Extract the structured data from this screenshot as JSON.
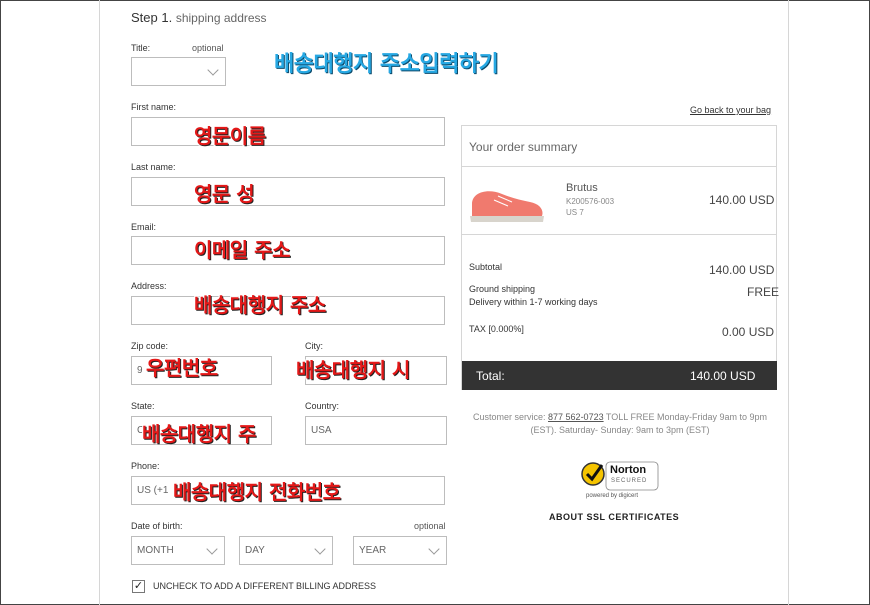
{
  "step": {
    "number": "Step 1.",
    "title": "shipping address"
  },
  "banner": "배송대행지 주소입력하기",
  "form": {
    "title_label": "Title:",
    "optional": "optional",
    "first_name_label": "First name:",
    "last_name_label": "Last name:",
    "email_label": "Email:",
    "address_label": "Address:",
    "zip_label": "Zip code:",
    "zip_value": "9",
    "city_label": "City:",
    "state_label": "State:",
    "state_value": "C",
    "country_label": "Country:",
    "country_value": "USA",
    "phone_label": "Phone:",
    "phone_value": "US (+1",
    "dob_label": "Date of birth:",
    "dob_optional": "optional",
    "month": "MONTH",
    "day": "DAY",
    "year": "YEAR",
    "billing_check": "UNCHECK TO ADD A DIFFERENT BILLING ADDRESS",
    "billing_checked": true
  },
  "annotations": {
    "first_name": "영문이름",
    "last_name": "영문 성",
    "email": "이메일 주소",
    "address": "배송대행지 주소",
    "zip": "우편번호",
    "city": "배송대행지 시",
    "state": "배송대행지 주",
    "phone": "배송대행지 전화번호"
  },
  "summary": {
    "back_link": "Go back to your bag",
    "title": "Your order summary",
    "product_name": "Brutus",
    "product_code": "K200576-003",
    "product_size": "US 7",
    "product_price": "140.00 USD",
    "subtotal_label": "Subtotal",
    "subtotal_value": "140.00 USD",
    "shipping_label": "Ground shipping",
    "shipping_note": "Delivery  within 1-7 working days",
    "shipping_value": "FREE",
    "tax_label": "TAX [0.000%]",
    "tax_value": "0.00 USD",
    "total_label": "Total:",
    "total_value": "140.00  USD"
  },
  "service": {
    "prefix": "Customer service:",
    "phone": "877 562-0723",
    "line1_rest": " TOLL FREE Monday-Friday 9am to 9pm",
    "line2": "(EST). Saturday- Sunday: 9am to 3pm (EST)"
  },
  "norton": {
    "brand": "Norton",
    "secured": "SECURED",
    "powered": "powered by digicert"
  },
  "ssl_link": "ABOUT SSL CERTIFICATES",
  "colors": {
    "annotation_red": "#e41818",
    "banner_blue": "#27a8e3",
    "total_bar": "#333333",
    "shoe": "#f07a6e"
  }
}
